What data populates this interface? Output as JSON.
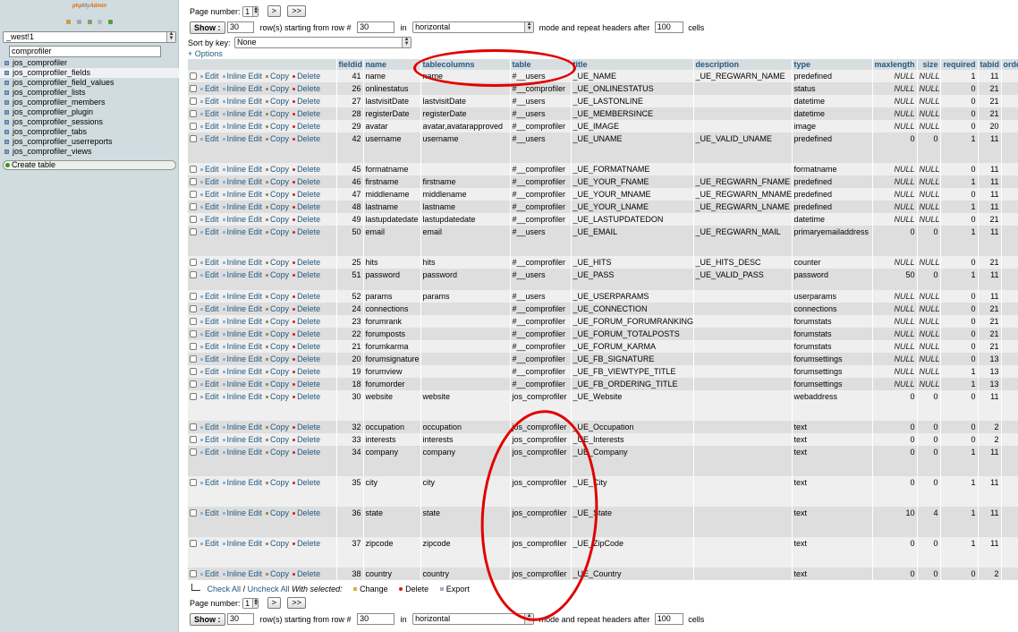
{
  "sidebar": {
    "logo_php": "php",
    "logo_my": "My",
    "logo_admin": "Admin",
    "db_selected": "_west!1",
    "filter_value": "comprofiler",
    "tables": [
      "jos_comprofiler",
      "jos_comprofiler_fields",
      "jos_comprofiler_field_values",
      "jos_comprofiler_lists",
      "jos_comprofiler_members",
      "jos_comprofiler_plugin",
      "jos_comprofiler_sessions",
      "jos_comprofiler_tabs",
      "jos_comprofiler_userreports",
      "jos_comprofiler_views"
    ],
    "selected_index": 1,
    "create_table": "Create table"
  },
  "nav": {
    "page_number_label": "Page number:",
    "page_value": "1",
    "next": ">",
    "last": ">>",
    "show_label": "Show :",
    "rows_value": "30",
    "rows_text": "row(s) starting from row #",
    "start_value": "30",
    "in_text": "in",
    "mode_value": "horizontal",
    "repeat_text": "mode and repeat headers after",
    "repeat_value": "100",
    "cells_text": "cells",
    "sort_label": "Sort by key:",
    "sort_value": "None",
    "options_link": "+ Options"
  },
  "columns": [
    "fieldid",
    "name",
    "tablecolumns",
    "table",
    "title",
    "description",
    "type",
    "maxlength",
    "size",
    "required",
    "tabid",
    "ordering"
  ],
  "actions": {
    "edit": "Edit",
    "inline": "Inline Edit",
    "copy": "Copy",
    "delete": "Delete"
  },
  "rows": [
    [
      "41",
      "name",
      "name",
      "#__users",
      "_UE_NAME",
      "_UE_REGWARN_NAME",
      "predefined",
      "NULL",
      "NULL",
      "1",
      "11"
    ],
    [
      "26",
      "onlinestatus",
      "",
      "#__comprofiler",
      "_UE_ONLINESTATUS",
      "",
      "status",
      "NULL",
      "NULL",
      "0",
      "21"
    ],
    [
      "27",
      "lastvisitDate",
      "lastvisitDate",
      "#__users",
      "_UE_LASTONLINE",
      "",
      "datetime",
      "NULL",
      "NULL",
      "0",
      "21"
    ],
    [
      "28",
      "registerDate",
      "registerDate",
      "#__users",
      "_UE_MEMBERSINCE",
      "",
      "datetime",
      "NULL",
      "NULL",
      "0",
      "21"
    ],
    [
      "29",
      "avatar",
      "avatar,avatarapproved",
      "#__comprofiler",
      "_UE_IMAGE",
      "",
      "image",
      "NULL",
      "NULL",
      "0",
      "20"
    ],
    [
      "42",
      "username",
      "username",
      "#__users",
      "_UE_UNAME",
      "_UE_VALID_UNAME",
      "predefined",
      "0",
      "0",
      "1",
      "11"
    ],
    [
      "45",
      "formatname",
      "",
      "#__comprofiler",
      "_UE_FORMATNAME",
      "",
      "formatname",
      "NULL",
      "NULL",
      "0",
      "11"
    ],
    [
      "46",
      "firstname",
      "firstname",
      "#__comprofiler",
      "_UE_YOUR_FNAME",
      "_UE_REGWARN_FNAME",
      "predefined",
      "NULL",
      "NULL",
      "1",
      "11"
    ],
    [
      "47",
      "middlename",
      "middlename",
      "#__comprofiler",
      "_UE_YOUR_MNAME",
      "_UE_REGWARN_MNAME",
      "predefined",
      "NULL",
      "NULL",
      "0",
      "11"
    ],
    [
      "48",
      "lastname",
      "lastname",
      "#__comprofiler",
      "_UE_YOUR_LNAME",
      "_UE_REGWARN_LNAME",
      "predefined",
      "NULL",
      "NULL",
      "1",
      "11"
    ],
    [
      "49",
      "lastupdatedate",
      "lastupdatedate",
      "#__comprofiler",
      "_UE_LASTUPDATEDON",
      "",
      "datetime",
      "NULL",
      "NULL",
      "0",
      "21"
    ],
    [
      "50",
      "email",
      "email",
      "#__users",
      "_UE_EMAIL",
      "_UE_REGWARN_MAIL",
      "primaryemailaddress",
      "0",
      "0",
      "1",
      "11"
    ],
    [
      "25",
      "hits",
      "hits",
      "#__comprofiler",
      "_UE_HITS",
      "_UE_HITS_DESC",
      "counter",
      "NULL",
      "NULL",
      "0",
      "21"
    ],
    [
      "51",
      "password",
      "password",
      "#__users",
      "_UE_PASS",
      "_UE_VALID_PASS",
      "password",
      "50",
      "0",
      "1",
      "11"
    ],
    [
      "52",
      "params",
      "params",
      "#__users",
      "_UE_USERPARAMS",
      "",
      "userparams",
      "NULL",
      "NULL",
      "0",
      "11"
    ],
    [
      "24",
      "connections",
      "",
      "#__comprofiler",
      "_UE_CONNECTION",
      "",
      "connections",
      "NULL",
      "NULL",
      "0",
      "21"
    ],
    [
      "23",
      "forumrank",
      "",
      "#__comprofiler",
      "_UE_FORUM_FORUMRANKING",
      "",
      "forumstats",
      "NULL",
      "NULL",
      "0",
      "21"
    ],
    [
      "22",
      "forumposts",
      "",
      "#__comprofiler",
      "_UE_FORUM_TOTALPOSTS",
      "",
      "forumstats",
      "NULL",
      "NULL",
      "0",
      "21"
    ],
    [
      "21",
      "forumkarma",
      "",
      "#__comprofiler",
      "_UE_FORUM_KARMA",
      "",
      "forumstats",
      "NULL",
      "NULL",
      "0",
      "21"
    ],
    [
      "20",
      "forumsignature",
      "",
      "#__comprofiler",
      "_UE_FB_SIGNATURE",
      "",
      "forumsettings",
      "NULL",
      "NULL",
      "0",
      "13"
    ],
    [
      "19",
      "forumview",
      "",
      "#__comprofiler",
      "_UE_FB_VIEWTYPE_TITLE",
      "",
      "forumsettings",
      "NULL",
      "NULL",
      "1",
      "13"
    ],
    [
      "18",
      "forumorder",
      "",
      "#__comprofiler",
      "_UE_FB_ORDERING_TITLE",
      "",
      "forumsettings",
      "NULL",
      "NULL",
      "1",
      "13"
    ],
    [
      "30",
      "website",
      "website",
      "jos_comprofiler",
      "_UE_Website",
      "",
      "webaddress",
      "0",
      "0",
      "0",
      "11"
    ],
    [
      "32",
      "occupation",
      "occupation",
      "jos_comprofiler",
      "_UE_Occupation",
      "",
      "text",
      "0",
      "0",
      "0",
      "2"
    ],
    [
      "33",
      "interests",
      "interests",
      "jos_comprofiler",
      "_UE_Interests",
      "",
      "text",
      "0",
      "0",
      "0",
      "2"
    ],
    [
      "34",
      "company",
      "company",
      "jos_comprofiler",
      "_UE_Company",
      "",
      "text",
      "0",
      "0",
      "1",
      "11"
    ],
    [
      "35",
      "city",
      "city",
      "jos_comprofiler",
      "_UE_City",
      "",
      "text",
      "0",
      "0",
      "1",
      "11"
    ],
    [
      "36",
      "state",
      "state",
      "jos_comprofiler",
      "_UE_State",
      "",
      "text",
      "10",
      "4",
      "1",
      "11"
    ],
    [
      "37",
      "zipcode",
      "zipcode",
      "jos_comprofiler",
      "_UE_ZipCode",
      "",
      "text",
      "0",
      "0",
      "1",
      "11"
    ],
    [
      "38",
      "country",
      "country",
      "jos_comprofiler",
      "_UE_Country",
      "",
      "text",
      "0",
      "0",
      "0",
      "2"
    ]
  ],
  "row_heights": [
    14,
    14,
    14,
    14,
    14,
    34,
    14,
    14,
    14,
    14,
    14,
    34,
    14,
    24,
    14,
    14,
    14,
    14,
    14,
    14,
    14,
    14,
    34,
    14,
    14,
    34,
    34,
    34,
    34,
    14
  ],
  "bulk": {
    "check_all": "Check All",
    "sep": "/",
    "uncheck_all": "Uncheck All",
    "with_selected": "With selected:",
    "change": "Change",
    "delete": "Delete",
    "export": "Export"
  },
  "colors": {
    "link": "#235a81",
    "annotation": "#e00000",
    "sidebar_bg": "#d0dce0"
  }
}
